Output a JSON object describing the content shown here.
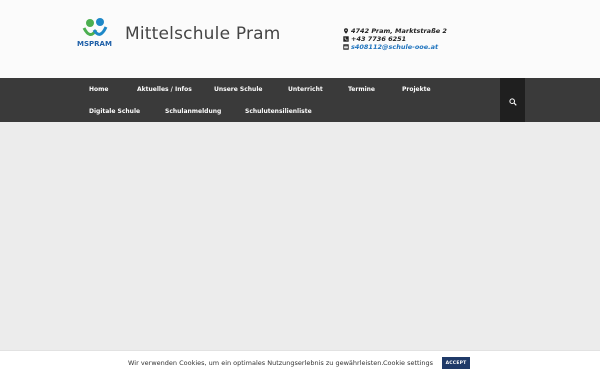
{
  "header": {
    "site_title": "Mittelschule Pram",
    "logo_text": "MSPRAM",
    "contact": {
      "address": "4742 Pram, Marktstraße 2",
      "phone": "+43 7736 6251",
      "email": "s408112@schule-ooe.at"
    }
  },
  "nav": {
    "items": [
      {
        "label": "Home"
      },
      {
        "label": "Aktuelles / Infos"
      },
      {
        "label": "Unsere Schule"
      },
      {
        "label": "Unterricht"
      },
      {
        "label": "Termine"
      },
      {
        "label": "Projekte"
      },
      {
        "label": "Digitale Schule"
      },
      {
        "label": "Schulanmeldung"
      },
      {
        "label": "Schulutensilienliste"
      }
    ],
    "search_icon": "search-icon"
  },
  "cookie_bar": {
    "text": "Wir verwenden Cookies, um ein optimales Nutzungserlebnis zu gewährleisten.",
    "settings_label": "Cookie settings",
    "accept_label": "ACCEPT"
  },
  "colors": {
    "nav_background": "#3a3a3a",
    "link": "#1e73be",
    "accept_button": "#1f3a68",
    "logo_green": "#4caf50",
    "logo_blue": "#1e88c8"
  }
}
